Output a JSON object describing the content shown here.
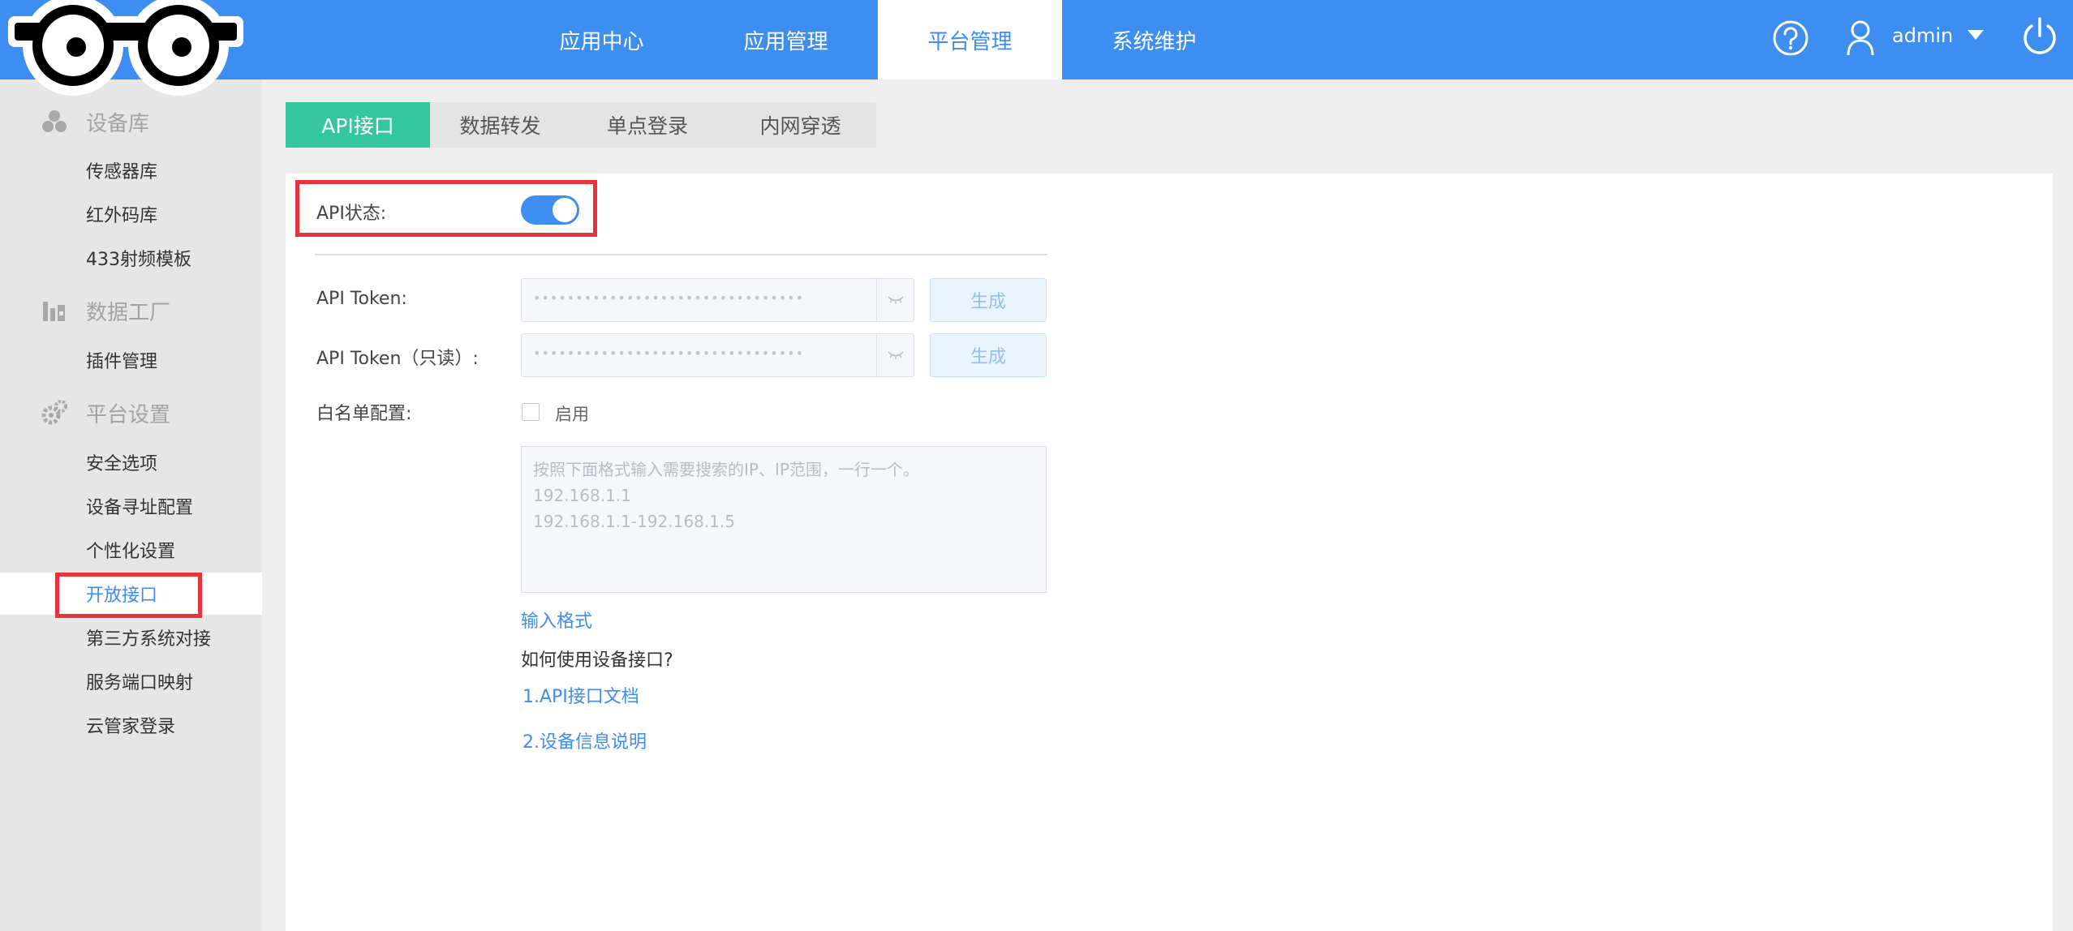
{
  "header": {
    "nav": [
      "应用中心",
      "应用管理",
      "平台管理",
      "系统维护"
    ],
    "active_nav": "平台管理",
    "username": "admin",
    "accent_color": "#3d8ef0"
  },
  "sidebar": {
    "groups": [
      {
        "label": "设备库",
        "icon": "devices-icon",
        "items": [
          "传感器库",
          "红外码库",
          "433射频模板"
        ]
      },
      {
        "label": "数据工厂",
        "icon": "factory-icon",
        "items": [
          "插件管理"
        ]
      },
      {
        "label": "平台设置",
        "icon": "gears-icon",
        "items": [
          "安全选项",
          "设备寻址配置",
          "个性化设置",
          "开放接口",
          "第三方系统对接",
          "服务端口映射",
          "云管家登录"
        ]
      }
    ],
    "active_item": "开放接口"
  },
  "tabs": {
    "items": [
      "API接口",
      "数据转发",
      "单点登录",
      "内网穿透"
    ],
    "active": "API接口",
    "active_color": "#34c79e"
  },
  "form": {
    "api_status_label": "API状态:",
    "api_status_enabled": true,
    "token_label": "API Token:",
    "token_readonly_label": "API Token（只读）:",
    "token_mask": "••••••••••••••••••••••••••••••••",
    "generate_label": "生成",
    "whitelist_label": "白名单配置:",
    "enable_label": "启用",
    "whitelist_enabled": false,
    "whitelist_placeholder": "按照下面格式输入需要搜索的IP、IP范围，一行一个。\n192.168.1.1\n192.168.1.1-192.168.1.5",
    "input_format_link": "输入格式",
    "howto_text": "如何使用设备接口?",
    "doc_link_1": "1.API接口文档",
    "doc_link_2": "2.设备信息说明"
  }
}
